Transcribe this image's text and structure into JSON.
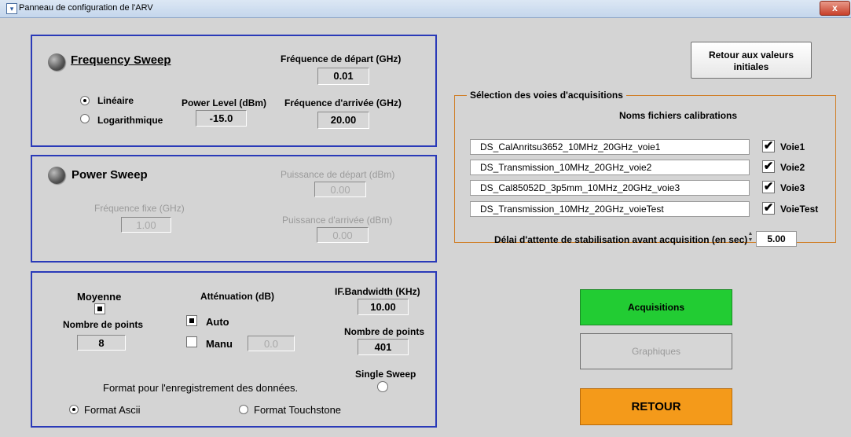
{
  "window": {
    "title": "Panneau de configuration de l'ARV",
    "close_label": "x"
  },
  "freq_sweep": {
    "title": "Frequency Sweep",
    "start_label": "Fréquence de départ (GHz)",
    "start_value": "0.01",
    "stop_label": "Fréquence d'arrivée (GHz)",
    "stop_value": "20.00",
    "power_label": "Power Level (dBm)",
    "power_value": "-15.0",
    "radio_linear": "Linéaire",
    "radio_log": "Logarithmique"
  },
  "power_sweep": {
    "title": "Power Sweep",
    "start_label": "Puissance de départ (dBm)",
    "start_value": "0.00",
    "stop_label": "Puissance d'arrivée (dBm)",
    "stop_value": "0.00",
    "fixed_freq_label": "Fréquence fixe (GHz)",
    "fixed_freq_value": "1.00"
  },
  "acq_settings": {
    "average_label": "Moyenne",
    "avg_points_label": "Nombre de points",
    "avg_points_value": "8",
    "attenuation_label": "Atténuation (dB)",
    "auto_label": "Auto",
    "manu_label": "Manu",
    "manu_value": "0.0",
    "ifbw_label": "IF.Bandwidth (KHz)",
    "ifbw_value": "10.00",
    "points_label": "Nombre de points",
    "points_value": "401",
    "single_sweep_label": "Single Sweep",
    "format_title": "Format pour l'enregistrement des données.",
    "format_ascii": "Format Ascii",
    "format_touchstone": "Format Touchstone"
  },
  "reset_button": {
    "line1": "Retour aux valeurs",
    "line2": "initiales"
  },
  "selection": {
    "legend": "Sélection des voies d'acquisitions",
    "header": "Noms fichiers calibrations",
    "rows": [
      {
        "file": "DS_CalAnritsu3652_10MHz_20GHz_voie1",
        "label": "Voie1",
        "check": "✔"
      },
      {
        "file": "DS_Transmission_10MHz_20GHz_voie2",
        "label": "Voie2",
        "check": "✔"
      },
      {
        "file": "DS_Cal85052D_3p5mm_10MHz_20GHz_voie3",
        "label": "Voie3",
        "check": "✔"
      },
      {
        "file": "DS_Transmission_10MHz_20GHz_voieTest",
        "label": "VoieTest",
        "check": "✔"
      }
    ],
    "delay_label": "Délai d'attente de stabilisation avant acquisition (en sec)",
    "delay_value": "5.00"
  },
  "actions": {
    "acquisitions": "Acquisitions",
    "graphiques": "Graphiques",
    "retour": "RETOUR"
  },
  "colors": {
    "acquisitions_bg": "#22cc33",
    "retour_bg": "#f49a1a",
    "panel_border": "#2a3ab8",
    "group_border": "#d0802a"
  }
}
